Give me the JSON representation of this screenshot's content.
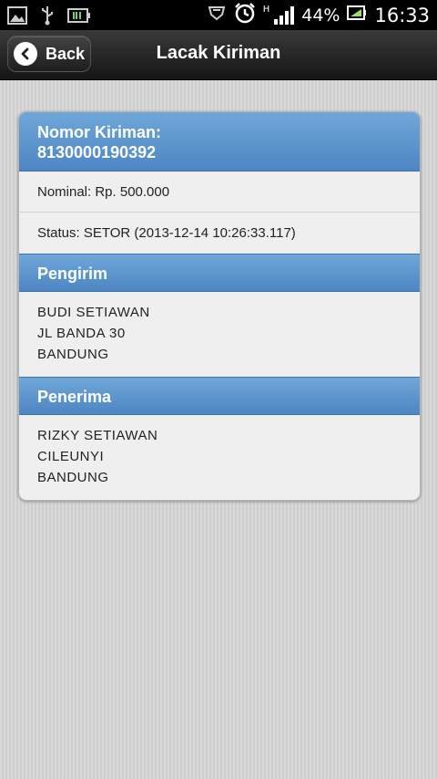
{
  "status_bar": {
    "battery_percent": "44%",
    "time": "16:33",
    "network_type": "H"
  },
  "header": {
    "back_label": "Back",
    "title": "Lacak Kiriman"
  },
  "shipment": {
    "number_label": "Nomor Kiriman:",
    "number": "8130000190392",
    "nominal": "Nominal: Rp. 500.000",
    "status": "Status: SETOR (2013-12-14 10:26:33.117)"
  },
  "sender": {
    "heading": "Pengirim",
    "lines": [
      "BUDI SETIAWAN",
      "JL BANDA 30",
      "BANDUNG"
    ]
  },
  "receiver": {
    "heading": "Penerima",
    "lines": [
      "RIZKY SETIAWAN",
      "CILEUNYI",
      "BANDUNG"
    ]
  },
  "colors": {
    "section_header": "#5b94cd",
    "app_header": "#222222"
  }
}
